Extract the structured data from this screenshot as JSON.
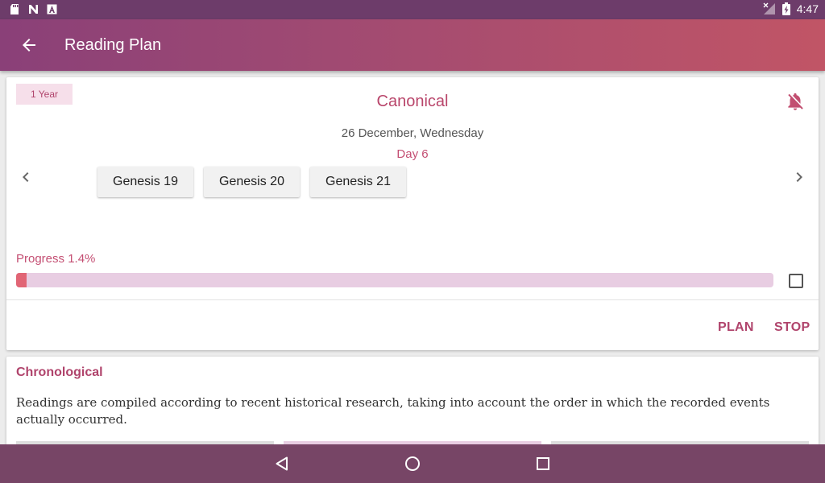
{
  "status_bar": {
    "time": "4:47",
    "left_icons": [
      "sd-card-icon",
      "n-notification-icon",
      "a-notification-icon"
    ],
    "right_icons": [
      "no-signal-icon",
      "battery-charging-icon"
    ]
  },
  "app_bar": {
    "title": "Reading Plan",
    "back_icon": "arrow-left-icon"
  },
  "plan_card": {
    "badge": "1 Year",
    "title": "Canonical",
    "notification_icon": "bell-off-icon",
    "date": "26 December, Wednesday",
    "day": "Day 6",
    "readings": [
      "Genesis 19",
      "Genesis 20",
      "Genesis 21"
    ],
    "progress_label": "Progress 1.4%",
    "progress": 1.4,
    "completed": false,
    "actions": {
      "plan": "PLAN",
      "stop": "STOP"
    }
  },
  "next_card": {
    "title": "Chronological",
    "description": "Readings are compiled according to recent historical research, taking into account the order in which the recorded events actually occurred."
  },
  "nav_bar": {
    "icons": [
      "triangle-back-icon",
      "circle-home-icon",
      "square-recents-icon"
    ]
  },
  "colors": {
    "accent": "#b9466b",
    "status_bar": "#6d3c6a",
    "nav_bar": "#774566",
    "progress_track": "#e8cde2",
    "progress_fill": "#e16575"
  }
}
